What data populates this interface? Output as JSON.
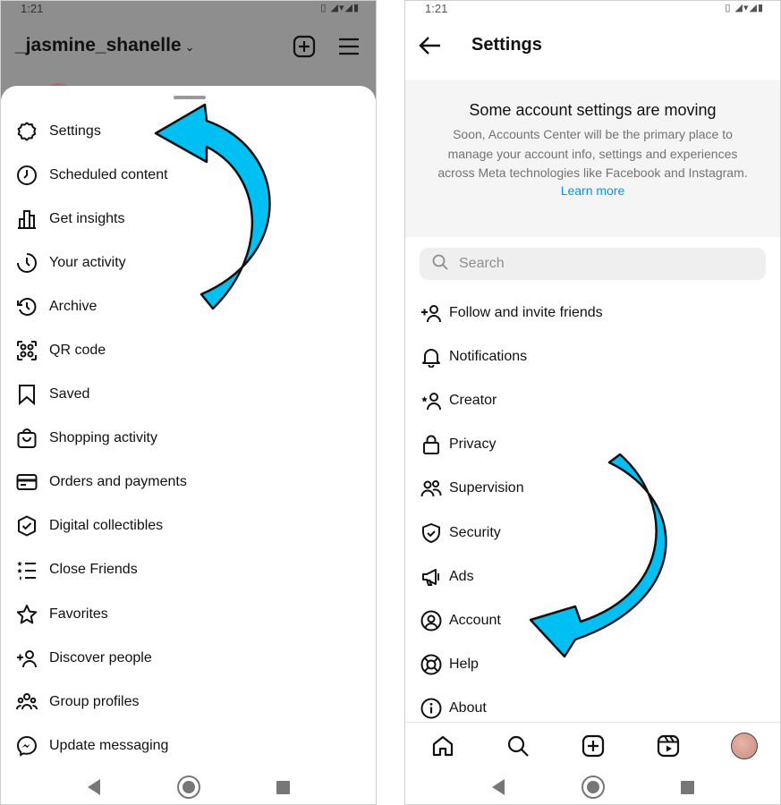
{
  "left": {
    "status": {
      "time": "1:21",
      "icons": "▯ ◢▾◢▮"
    },
    "header": {
      "username": "_jasmine_shanelle",
      "chevron": "⌄"
    },
    "menu": [
      {
        "label": "Settings",
        "icon": "settings-icon"
      },
      {
        "label": "Scheduled content",
        "icon": "clock-icon"
      },
      {
        "label": "Get insights",
        "icon": "bar-chart-icon"
      },
      {
        "label": "Your activity",
        "icon": "activity-icon"
      },
      {
        "label": "Archive",
        "icon": "archive-icon"
      },
      {
        "label": "QR code",
        "icon": "qr-code-icon"
      },
      {
        "label": "Saved",
        "icon": "bookmark-icon"
      },
      {
        "label": "Shopping activity",
        "icon": "shopping-bag-icon"
      },
      {
        "label": "Orders and payments",
        "icon": "credit-card-icon"
      },
      {
        "label": "Digital collectibles",
        "icon": "badge-check-icon"
      },
      {
        "label": "Close Friends",
        "icon": "close-friends-icon"
      },
      {
        "label": "Favorites",
        "icon": "star-icon"
      },
      {
        "label": "Discover people",
        "icon": "add-person-icon"
      },
      {
        "label": "Group profiles",
        "icon": "group-icon"
      },
      {
        "label": "Update messaging",
        "icon": "messenger-icon"
      }
    ]
  },
  "right": {
    "status": {
      "time": "1:21",
      "icons": "▯ ◢▾◢▮"
    },
    "header": {
      "title": "Settings"
    },
    "notice": {
      "title": "Some account settings are moving",
      "body": "Soon, Accounts Center will be the primary place to manage your account info, settings and experiences across Meta technologies like Facebook and Instagram.",
      "link": "Learn more"
    },
    "search": {
      "placeholder": "Search",
      "value": ""
    },
    "items": [
      {
        "label": "Follow and invite friends",
        "icon": "add-person-icon"
      },
      {
        "label": "Notifications",
        "icon": "bell-icon"
      },
      {
        "label": "Creator",
        "icon": "creator-icon"
      },
      {
        "label": "Privacy",
        "icon": "lock-icon"
      },
      {
        "label": "Supervision",
        "icon": "people-icon"
      },
      {
        "label": "Security",
        "icon": "shield-icon"
      },
      {
        "label": "Ads",
        "icon": "megaphone-icon"
      },
      {
        "label": "Account",
        "icon": "account-icon"
      },
      {
        "label": "Help",
        "icon": "lifebuoy-icon"
      },
      {
        "label": "About",
        "icon": "info-icon"
      }
    ]
  },
  "colors": {
    "accent_arrow": "#00bff3",
    "link": "#0095f6",
    "dim_overlay": "#8e8e8e"
  }
}
